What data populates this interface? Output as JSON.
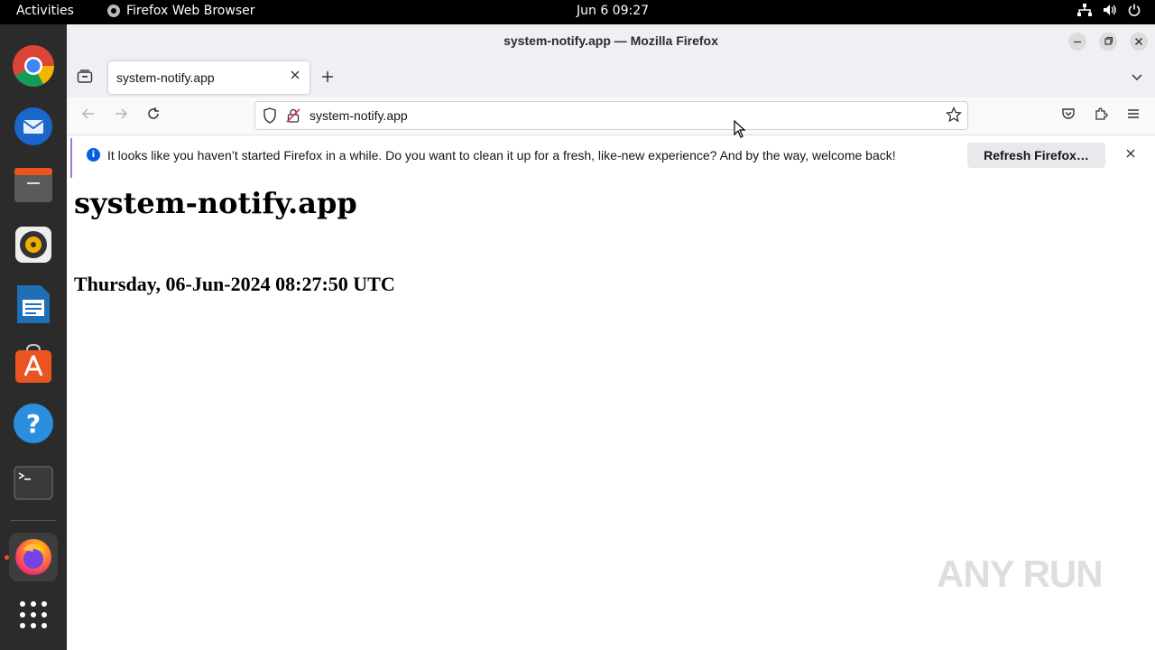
{
  "topbar": {
    "activities": "Activities",
    "app_name": "Firefox Web Browser",
    "clock": "Jun 6  09:27"
  },
  "dock": {
    "items": [
      "Google Chrome",
      "Thunderbird Mail",
      "Files",
      "Rhythmbox",
      "LibreOffice Writer",
      "Ubuntu Software",
      "Help",
      "Terminal",
      "Firefox Web Browser",
      "Show Applications"
    ]
  },
  "window": {
    "title": "system-notify.app — Mozilla Firefox"
  },
  "tab": {
    "label": "system-notify.app"
  },
  "urlbar": {
    "url": "system-notify.app"
  },
  "notification": {
    "message": "It looks like you haven’t started Firefox in a while. Do you want to clean it up for a fresh, like-new experience? And by the way, welcome back!",
    "button": "Refresh Firefox…"
  },
  "page": {
    "heading": "system-notify.app",
    "datetime": "Thursday, 06-Jun-2024 08:27:50 UTC"
  },
  "watermark": "ANY RUN"
}
